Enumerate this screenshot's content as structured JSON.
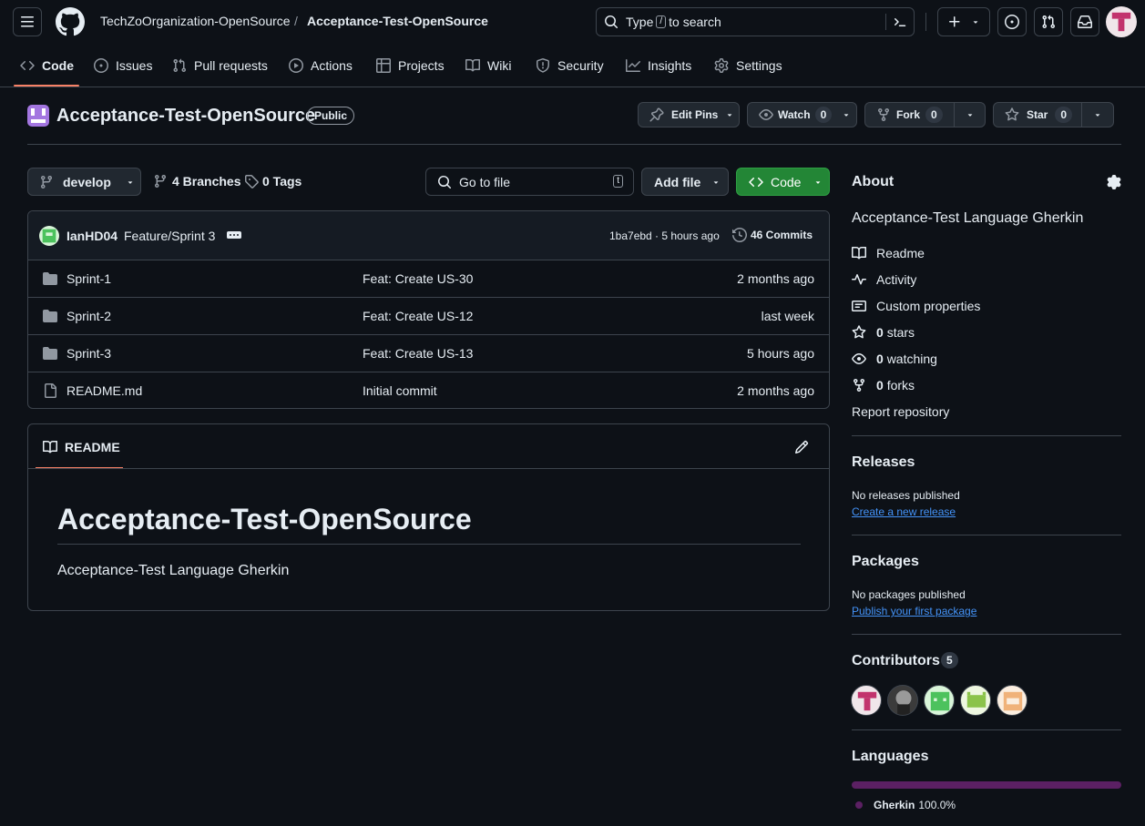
{
  "header": {
    "org": "TechZoOrganization-OpenSource",
    "separator": "/",
    "repo": "Acceptance-Test-OpenSource",
    "search_before": "Type",
    "search_key": "/",
    "search_after": "to search"
  },
  "nav_tabs": [
    {
      "label": "Code",
      "icon": "code-icon",
      "active": true
    },
    {
      "label": "Issues",
      "icon": "issue-icon"
    },
    {
      "label": "Pull requests",
      "icon": "pull-request-icon"
    },
    {
      "label": "Actions",
      "icon": "play-icon"
    },
    {
      "label": "Projects",
      "icon": "table-icon"
    },
    {
      "label": "Wiki",
      "icon": "book-icon"
    },
    {
      "label": "Security",
      "icon": "shield-icon"
    },
    {
      "label": "Insights",
      "icon": "graph-icon"
    },
    {
      "label": "Settings",
      "icon": "gear-icon"
    }
  ],
  "repo_header": {
    "name": "Acceptance-Test-OpenSource",
    "visibility": "Public",
    "edit_pins": "Edit Pins",
    "watch": "Watch",
    "watch_count": "0",
    "fork": "Fork",
    "fork_count": "0",
    "star": "Star",
    "star_count": "0"
  },
  "toolbar": {
    "branch": "develop",
    "branches": "4 Branches",
    "tags": "0 Tags",
    "goto_placeholder": "Go to file",
    "goto_key": "t",
    "add_file": "Add file",
    "code": "Code"
  },
  "commit": {
    "author": "IanHD04",
    "message": "Feature/Sprint 3",
    "hash_time": "1ba7ebd · 5 hours ago",
    "commits": "46 Commits"
  },
  "files": [
    {
      "name": "Sprint-1",
      "type": "folder",
      "message": "Feat: Create US-30",
      "date": "2 months ago"
    },
    {
      "name": "Sprint-2",
      "type": "folder",
      "message": "Feat: Create US-12",
      "date": "last week"
    },
    {
      "name": "Sprint-3",
      "type": "folder",
      "message": "Feat: Create US-13",
      "date": "5 hours ago"
    },
    {
      "name": "README.md",
      "type": "file",
      "message": "Initial commit",
      "date": "2 months ago"
    }
  ],
  "readme": {
    "tab": "README",
    "title": "Acceptance-Test-OpenSource",
    "body": "Acceptance-Test Language Gherkin"
  },
  "about": {
    "heading": "About",
    "description": "Acceptance-Test Language Gherkin",
    "readme": "Readme",
    "activity": "Activity",
    "custom_properties": "Custom properties",
    "stars_count": "0",
    "stars_label": "stars",
    "watching_count": "0",
    "watching_label": "watching",
    "forks_count": "0",
    "forks_label": "forks",
    "report": "Report repository"
  },
  "releases": {
    "heading": "Releases",
    "none": "No releases published",
    "link": "Create a new release"
  },
  "packages": {
    "heading": "Packages",
    "none": "No packages published",
    "link": "Publish your first package"
  },
  "contributors": {
    "heading": "Contributors",
    "count": "5"
  },
  "languages": {
    "heading": "Languages",
    "items": [
      {
        "name": "Gherkin",
        "percent": "100.0%",
        "color": "#5b2063",
        "fraction": 1.0
      }
    ]
  },
  "colors": {
    "accent_green": "#238636",
    "link_blue": "#4493f8",
    "tab_underline": "#f78166"
  }
}
